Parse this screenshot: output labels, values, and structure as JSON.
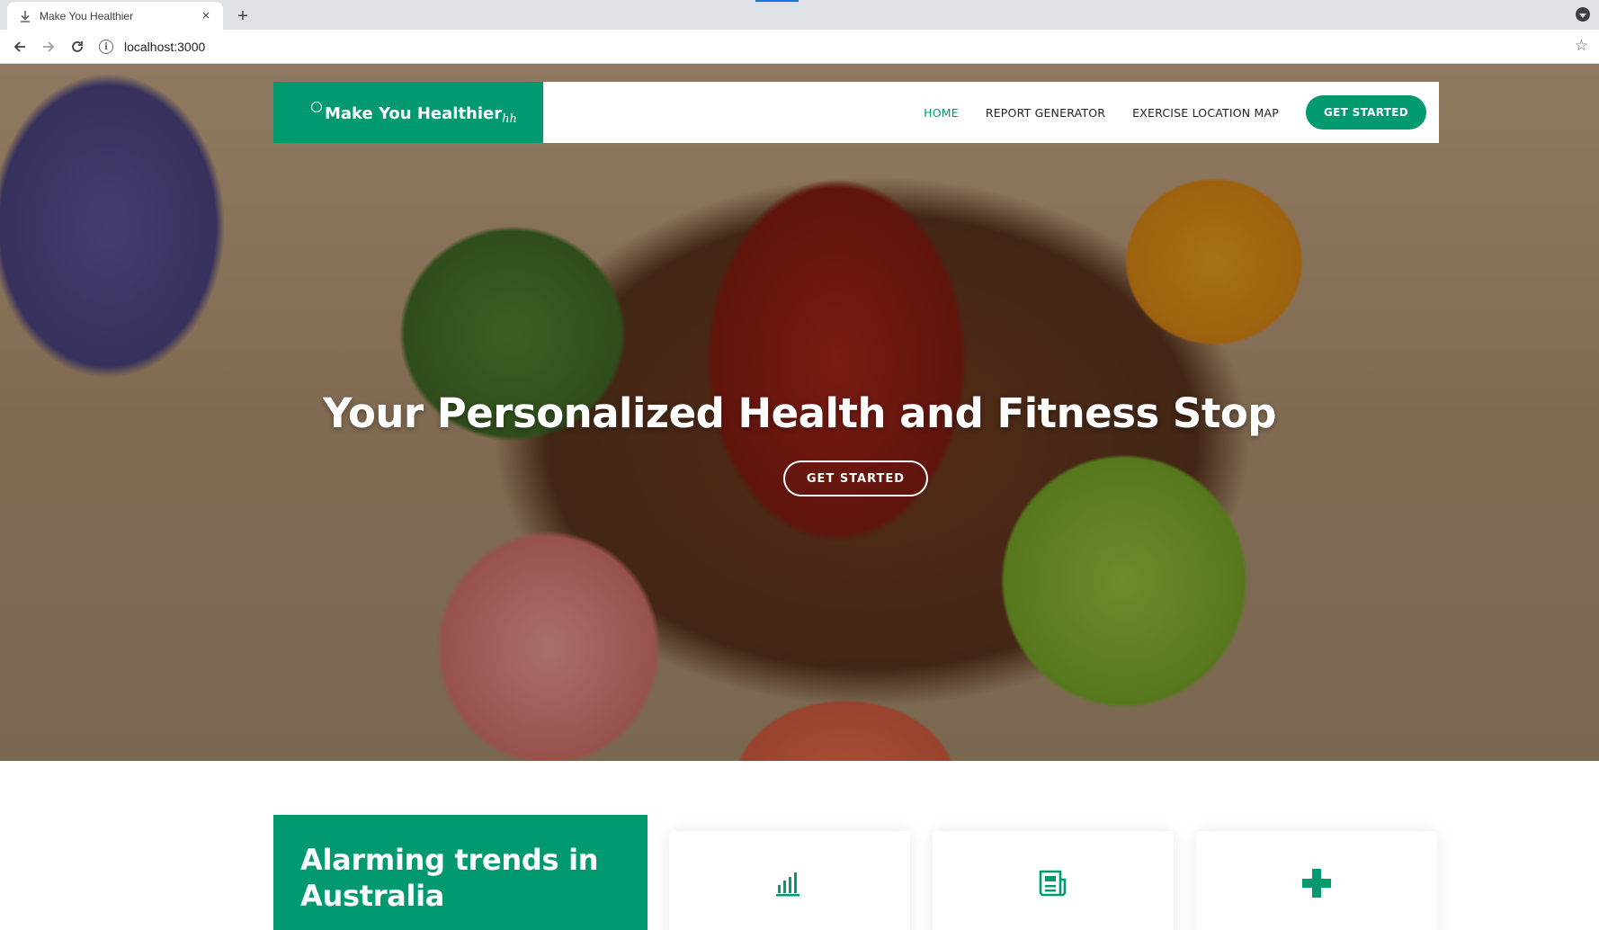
{
  "browser": {
    "tab_title": "Make You Healthier",
    "tab_close": "×",
    "new_tab": "+",
    "url": "localhost:3000",
    "info_icon": "i"
  },
  "header": {
    "logo_text": "Make You Healthier",
    "logo_tail": "ℎℎ",
    "nav": [
      {
        "label": "HOME",
        "active": true
      },
      {
        "label": "REPORT GENERATOR",
        "active": false
      },
      {
        "label": "EXERCISE LOCATION MAP",
        "active": false
      }
    ],
    "cta_label": "GET STARTED"
  },
  "hero": {
    "title": "Your Personalized Health and Fitness Stop",
    "cta_label": "GET STARTED"
  },
  "trends": {
    "title": "Alarming trends in Australia"
  },
  "cards": [
    {
      "icon": "bar-chart-icon"
    },
    {
      "icon": "newspaper-icon"
    },
    {
      "icon": "plus-icon"
    }
  ],
  "colors": {
    "accent": "#009970",
    "accent_text": "#ffffff"
  }
}
